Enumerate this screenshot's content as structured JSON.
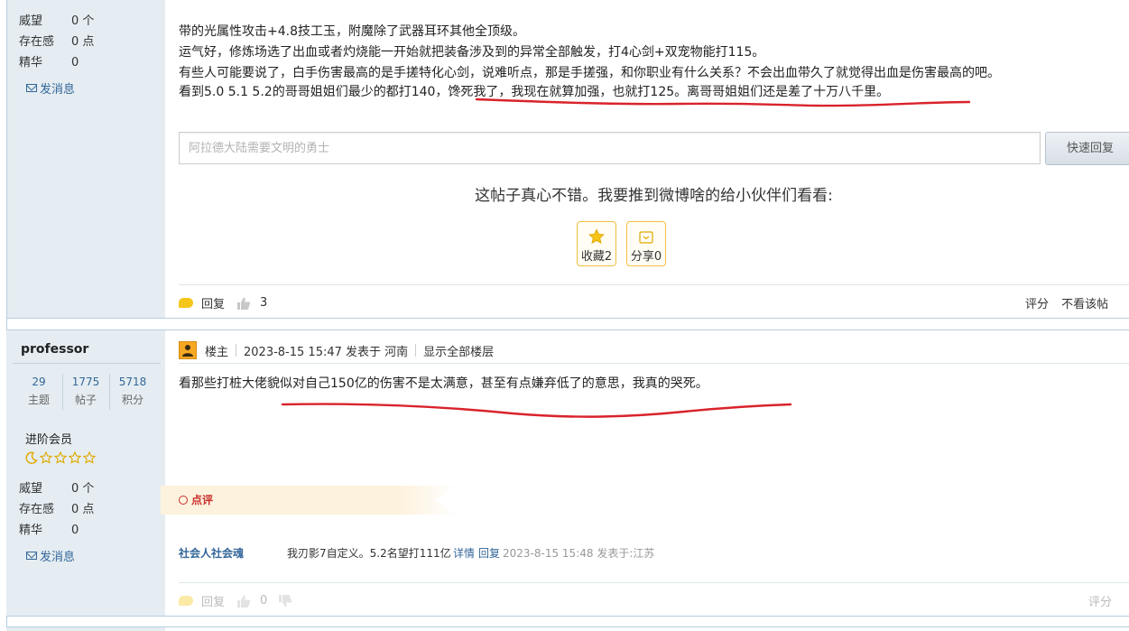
{
  "post1": {
    "author_stats": [
      {
        "key": "威望",
        "value": "0 个"
      },
      {
        "key": "存在感",
        "value": "0 点"
      },
      {
        "key": "精华",
        "value": "0"
      }
    ],
    "send_message": "发消息",
    "lines": [
      "带的光属性攻击+4.8技工玉，附魔除了武器耳环其他全顶级。",
      "运气好，修炼场选了出血或者灼烧能一开始就把装备涉及到的异常全部触发，打4心剑+双宠物能打115。",
      "有些人可能要说了，白手伤害最高的是手搓特化心剑，说难听点，那是手搓强，和你职业有什么关系？不会出血带久了就觉得出血是伤害最高的吧。",
      "看到5.0 5.1 5.2的哥哥姐姐们最少的都打140，馋死我了，我现在就算加强，也就打125。离哥哥姐姐们还是差了十万八千里。"
    ],
    "reply_placeholder": "阿拉德大陆需要文明的勇士",
    "quick_reply": "快速回复",
    "share_title": "这帖子真心不错。我要推到微博啥的给小伙伴们看看:",
    "favorite_label": "收藏2",
    "share_label": "分享0",
    "reply_label": "回复",
    "like_count": "3",
    "rate_label": "评分",
    "hide_label": "不看该帖"
  },
  "post2": {
    "username": "professor",
    "stats": [
      {
        "num": "29",
        "label": "主题"
      },
      {
        "num": "1775",
        "label": "帖子"
      },
      {
        "num": "5718",
        "label": "积分"
      }
    ],
    "rank": "进阶会员",
    "author_stats": [
      {
        "key": "威望",
        "value": "0 个"
      },
      {
        "key": "存在感",
        "value": "0 点"
      },
      {
        "key": "精华",
        "value": "0"
      }
    ],
    "send_message": "发消息",
    "op_label": "楼主",
    "datetime": "2023-8-15 15:47 发表于 河南",
    "show_all": "显示全部楼层",
    "content": "看那些打桩大佬貌似对自己150亿的伤害不是太满意，甚至有点嫌弃低了的意思，我真的哭死。",
    "dianping_label": "点评",
    "comment": {
      "user": "社会人社会魂",
      "text": "我刃影7自定义。5.2名望打111亿",
      "detail": "详情",
      "reply": "回复",
      "meta": "2023-8-15 15:48 发表于:江苏"
    },
    "reply_label": "回复",
    "like_count": "0",
    "rate_label": "评分"
  },
  "colors": {
    "sidebar_bg": "#e5edf2",
    "link_blue": "#336699",
    "accent_yellow": "#f5c518",
    "underline_red": "#d9232b"
  }
}
